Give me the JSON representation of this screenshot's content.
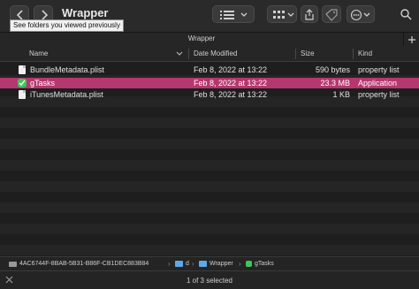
{
  "toolbar": {
    "title": "Wrapper",
    "tooltip": "See folders you viewed previously",
    "icons": [
      "back-icon",
      "forward-icon",
      "list-view-icon",
      "grid-view-icon",
      "share-icon",
      "tag-icon",
      "more-icon"
    ]
  },
  "tabbar": {
    "label": "Wrapper",
    "new_tab_icon": "plus-icon"
  },
  "columns": {
    "name": "Name",
    "date": "Date Modified",
    "size": "Size",
    "kind": "Kind"
  },
  "files": [
    {
      "name": "BundleMetadata.plist",
      "date": "Feb 8, 2022 at 13:22",
      "size": "590 bytes",
      "kind": "property list",
      "icon": "plist-file-icon",
      "selected": false
    },
    {
      "name": "gTasks",
      "date": "Feb 8, 2022 at 13:22",
      "size": "23.3 MB",
      "kind": "Application",
      "icon": "app-icon",
      "selected": true
    },
    {
      "name": "iTunesMetadata.plist",
      "date": "Feb 8, 2022 at 13:22",
      "size": "1 KB",
      "kind": "property list",
      "icon": "plist-file-icon",
      "selected": false
    }
  ],
  "pathbar": {
    "items": [
      "4AC6744F-8BAB-5B31-B86F-CB1DEC883B84",
      "d",
      "Wrapper",
      "gTasks"
    ]
  },
  "status": {
    "text": "1 of 3 selected"
  },
  "colors": {
    "selection": "#b5376f",
    "app_icon": "#3fc55c",
    "folder": "#5fa8e8"
  }
}
